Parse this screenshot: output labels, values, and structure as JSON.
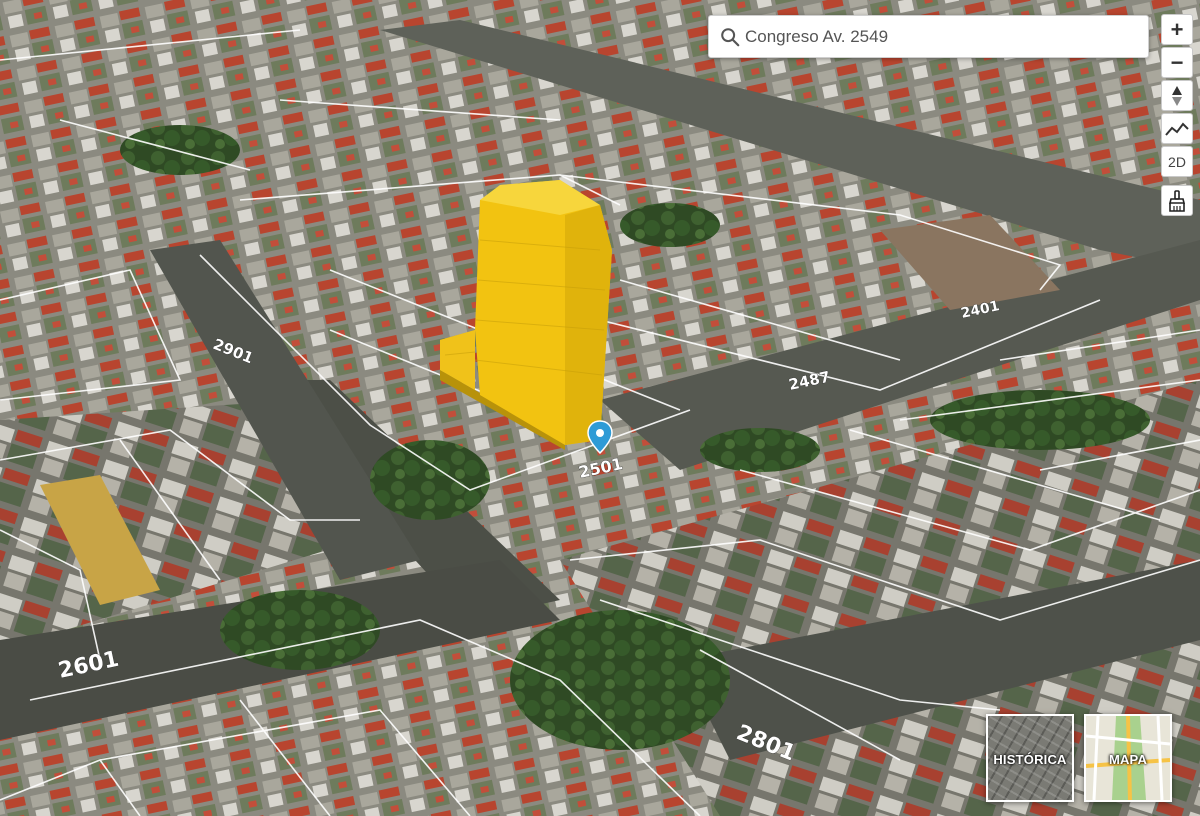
{
  "search": {
    "placeholder": "Congreso Av. 2549",
    "value": ""
  },
  "controls": {
    "zoom_in": "+",
    "zoom_out": "−",
    "mode_2d": "2D"
  },
  "basemaps": [
    {
      "label": "HISTÓRICA"
    },
    {
      "label": "MAPA"
    }
  ],
  "street_numbers": {
    "n2901": "2901",
    "n2401": "2401",
    "n2487": "2487",
    "n2501": "2501",
    "n2601": "2601",
    "n2801": "2801"
  },
  "colors": {
    "building": "#f2c311",
    "marker": "#2e9bd6",
    "parcel_lines": "#ffffff"
  }
}
